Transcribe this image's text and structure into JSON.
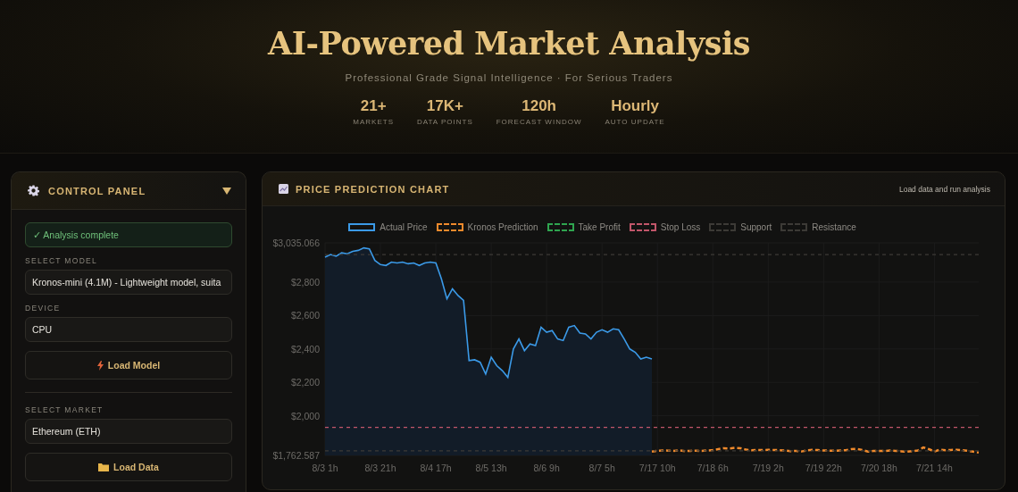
{
  "header": {
    "title": "AI-Powered Market Analysis",
    "subtitle": "Professional Grade Signal Intelligence · For Serious Traders",
    "stats": [
      {
        "value": "21+",
        "label": "MARKETS"
      },
      {
        "value": "17K+",
        "label": "DATA POINTS"
      },
      {
        "value": "120h",
        "label": "FORECAST WINDOW"
      },
      {
        "value": "Hourly",
        "label": "AUTO UPDATE"
      }
    ]
  },
  "control_panel": {
    "title": "CONTROL PANEL",
    "expanded": true,
    "status": "✓ Analysis complete",
    "items": [
      {
        "kind": "select",
        "label": "SELECT MODEL",
        "value": "Kronos-mini (4.1M) - Lightweight model, suita"
      },
      {
        "kind": "select",
        "label": "DEVICE",
        "value": "CPU"
      },
      {
        "kind": "button",
        "label": "Load Model"
      },
      {
        "kind": "divider"
      },
      {
        "kind": "select",
        "label": "SELECT MARKET",
        "value": "Ethereum (ETH)"
      },
      {
        "kind": "button",
        "label": "Load Data"
      }
    ]
  },
  "chart_panel": {
    "title": "PRICE PREDICTION CHART",
    "status": "Load data and run analysis",
    "chart_data": {
      "type": "line",
      "grid": true,
      "categories": [
        "8/3 1h",
        null,
        null,
        null,
        null,
        null,
        null,
        null,
        null,
        null,
        "8/3 21h",
        null,
        null,
        null,
        null,
        null,
        null,
        null,
        null,
        null,
        "8/4 17h",
        null,
        null,
        null,
        null,
        null,
        null,
        null,
        null,
        null,
        "8/5 13h",
        null,
        null,
        null,
        null,
        null,
        null,
        null,
        null,
        null,
        "8/6 9h",
        null,
        null,
        null,
        null,
        null,
        null,
        null,
        null,
        null,
        "8/7 5h",
        null,
        null,
        null,
        null,
        null,
        null,
        null,
        null,
        null,
        "7/17 10h",
        null,
        null,
        null,
        null,
        null,
        null,
        null,
        null,
        null,
        "7/18 6h",
        null,
        null,
        null,
        null,
        null,
        null,
        null,
        null,
        null,
        "7/19 2h",
        null,
        null,
        null,
        null,
        null,
        null,
        null,
        null,
        null,
        "7/19 22h",
        null,
        null,
        null,
        null,
        null,
        null,
        null,
        null,
        null,
        "7/20 18h",
        null,
        null,
        null,
        null,
        null,
        null,
        null,
        null,
        null,
        "7/21 14h",
        null,
        null,
        null,
        null,
        null,
        null,
        null,
        null
      ],
      "ylim": [
        1762.587,
        3035.066
      ],
      "yticks": [
        {
          "value": 1762.587,
          "label": "$1,762.587"
        },
        {
          "value": 2000,
          "label": "$2,000"
        },
        {
          "value": 2200,
          "label": "$2,200"
        },
        {
          "value": 2400,
          "label": "$2,400"
        },
        {
          "value": 2600,
          "label": "$2,600"
        },
        {
          "value": 2800,
          "label": "$2,800"
        },
        {
          "value": 3035.066,
          "label": "$3,035.066"
        }
      ],
      "series": [
        {
          "name": "Actual Price",
          "color": "#3b9ae8",
          "line_style": "solid",
          "values": [
            2950,
            2965,
            2955,
            2975,
            2970,
            2985,
            2990,
            3005,
            3000,
            2930,
            2905,
            2900,
            2920,
            2915,
            2920,
            2910,
            2915,
            2900,
            2915,
            2920,
            2915,
            2820,
            2700,
            2760,
            2720,
            2690,
            2330,
            2335,
            2320,
            2250,
            2350,
            2300,
            2270,
            2230,
            2400,
            2460,
            2390,
            2430,
            2420,
            2530,
            2500,
            2510,
            2460,
            2450,
            2530,
            2540,
            2495,
            2490,
            2460,
            2500,
            2515,
            2500,
            2520,
            2515,
            2460,
            2400,
            2380,
            2340,
            2350,
            2340,
            null,
            null,
            null,
            null,
            null,
            null,
            null,
            null,
            null,
            null,
            null,
            null,
            null,
            null,
            null,
            null,
            null,
            null,
            null,
            null,
            null,
            null,
            null,
            null,
            null,
            null,
            null,
            null,
            null,
            null,
            null,
            null,
            null,
            null,
            null,
            null,
            null,
            null,
            null,
            null,
            null,
            null,
            null,
            null,
            null,
            null,
            null,
            null,
            null,
            null,
            null,
            null,
            null,
            null,
            null,
            null,
            null,
            null,
            null
          ]
        },
        {
          "name": "Kronos Prediction",
          "color": "#f08a2c",
          "line_style": "dashed",
          "values": [
            null,
            null,
            null,
            null,
            null,
            null,
            null,
            null,
            null,
            null,
            null,
            null,
            null,
            null,
            null,
            null,
            null,
            null,
            null,
            null,
            null,
            null,
            null,
            null,
            null,
            null,
            null,
            null,
            null,
            null,
            null,
            null,
            null,
            null,
            null,
            null,
            null,
            null,
            null,
            null,
            null,
            null,
            null,
            null,
            null,
            null,
            null,
            null,
            null,
            null,
            null,
            null,
            null,
            null,
            null,
            null,
            null,
            null,
            null,
            1785,
            1790,
            1792,
            1791,
            1790,
            1793,
            1788,
            1790,
            1791,
            1789,
            1792,
            1794,
            1800,
            1806,
            1803,
            1808,
            1806,
            1797,
            1793,
            1795,
            1794,
            1796,
            1795,
            1794,
            1792,
            1788,
            1790,
            1786,
            1793,
            1796,
            1794,
            1792,
            1791,
            1790,
            1792,
            1793,
            1800,
            1801,
            1795,
            1785,
            1789,
            1790,
            1789,
            1792,
            1790,
            1787,
            1785,
            1788,
            1792,
            1810,
            1800,
            1786,
            1797,
            1793,
            1795,
            1796,
            1794,
            1790,
            1785,
            1780
          ]
        }
      ],
      "ref_lines": [
        {
          "label": "Take Profit",
          "color": "#2fa54f"
        },
        {
          "label": "Stop Loss",
          "color": "#c2566a",
          "axis": "y",
          "value": 1930
        },
        {
          "label": "Support",
          "color": "#3c3a36",
          "axis": "y",
          "value": 1790
        },
        {
          "label": "Resistance",
          "color": "#3c3a36",
          "axis": "y",
          "value": 2965
        }
      ]
    }
  }
}
